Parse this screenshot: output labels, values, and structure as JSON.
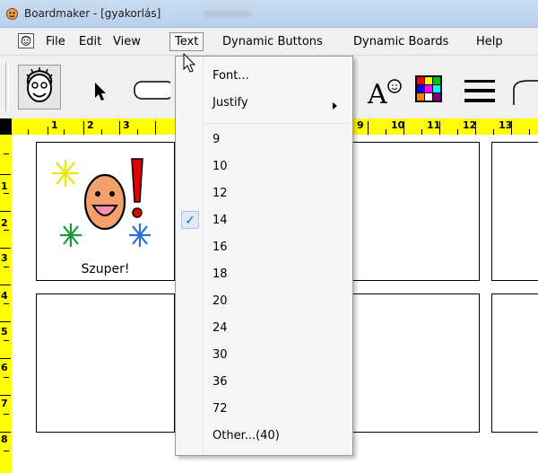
{
  "window": {
    "title": "Boardmaker - [gyakorlás]"
  },
  "menubar": {
    "items": [
      "File",
      "Edit",
      "View",
      "Text",
      "Dynamic Buttons",
      "Dynamic Boards",
      "Help"
    ],
    "open_menu": "Text"
  },
  "toolbar": {
    "buttons": [
      "face-symbol-icon",
      "pointer-arrow-icon",
      "rounded-rect-icon",
      "letter-a-face-icon",
      "color-grid-icon",
      "line-thickness-icon",
      "curve-icon"
    ]
  },
  "ruler": {
    "horizontal": [
      "1",
      "2",
      "3",
      "9",
      "10",
      "11",
      "12",
      "13"
    ],
    "vertical": [
      "1",
      "2",
      "3",
      "4",
      "5",
      "6",
      "7",
      "8"
    ]
  },
  "board": {
    "cell_label": "Szuper!"
  },
  "text_menu": {
    "font": "Font...",
    "justify": "Justify",
    "sizes": [
      "9",
      "10",
      "12",
      "14",
      "16",
      "18",
      "20",
      "24",
      "30",
      "36",
      "72"
    ],
    "checked_size": "14",
    "other": "Other...(40)"
  }
}
